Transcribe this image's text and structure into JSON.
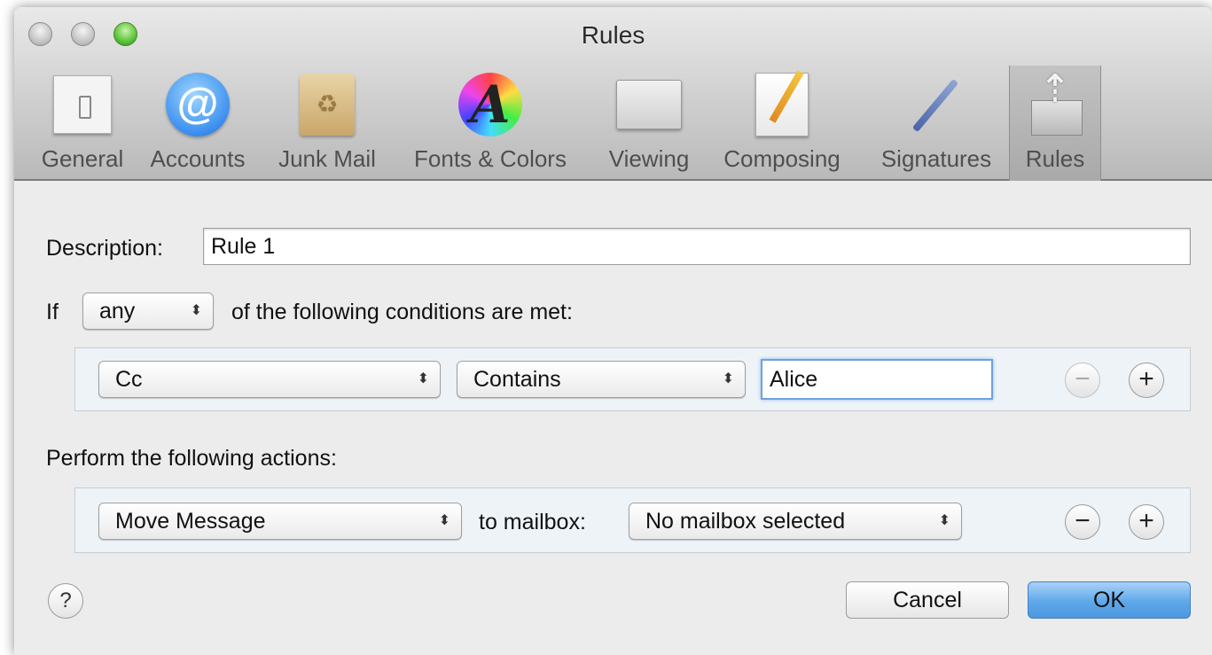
{
  "window": {
    "title": "Rules"
  },
  "toolbar": {
    "items": [
      {
        "label": "General",
        "icon": "general-switch-icon"
      },
      {
        "label": "Accounts",
        "icon": "at-sign-icon"
      },
      {
        "label": "Junk Mail",
        "icon": "junk-mail-bin-icon"
      },
      {
        "label": "Fonts & Colors",
        "icon": "fonts-color-wheel-icon"
      },
      {
        "label": "Viewing",
        "icon": "viewing-glasses-icon"
      },
      {
        "label": "Composing",
        "icon": "composing-pencil-icon"
      },
      {
        "label": "Signatures",
        "icon": "signature-pen-icon"
      },
      {
        "label": "Rules",
        "icon": "rules-mailbox-arrows-icon"
      }
    ],
    "selected": "Rules"
  },
  "description": {
    "label": "Description:",
    "value": "Rule 1"
  },
  "conditions": {
    "if_label": "If",
    "match_value": "any",
    "suffix_label": "of the following conditions are met:",
    "rows": [
      {
        "field": "Cc",
        "operator": "Contains",
        "value": "Alice",
        "remove": "−",
        "add": "+"
      }
    ]
  },
  "actions": {
    "header": "Perform the following actions:",
    "rows": [
      {
        "action": "Move Message",
        "to_label": "to mailbox:",
        "mailbox": "No mailbox selected",
        "remove": "−",
        "add": "+"
      }
    ]
  },
  "buttons": {
    "help": "?",
    "cancel": "Cancel",
    "ok": "OK"
  },
  "colors": {
    "default_button": "#5ea7ea",
    "focus_ring": "#6da2dc",
    "row_bg": "#eef3f8"
  }
}
